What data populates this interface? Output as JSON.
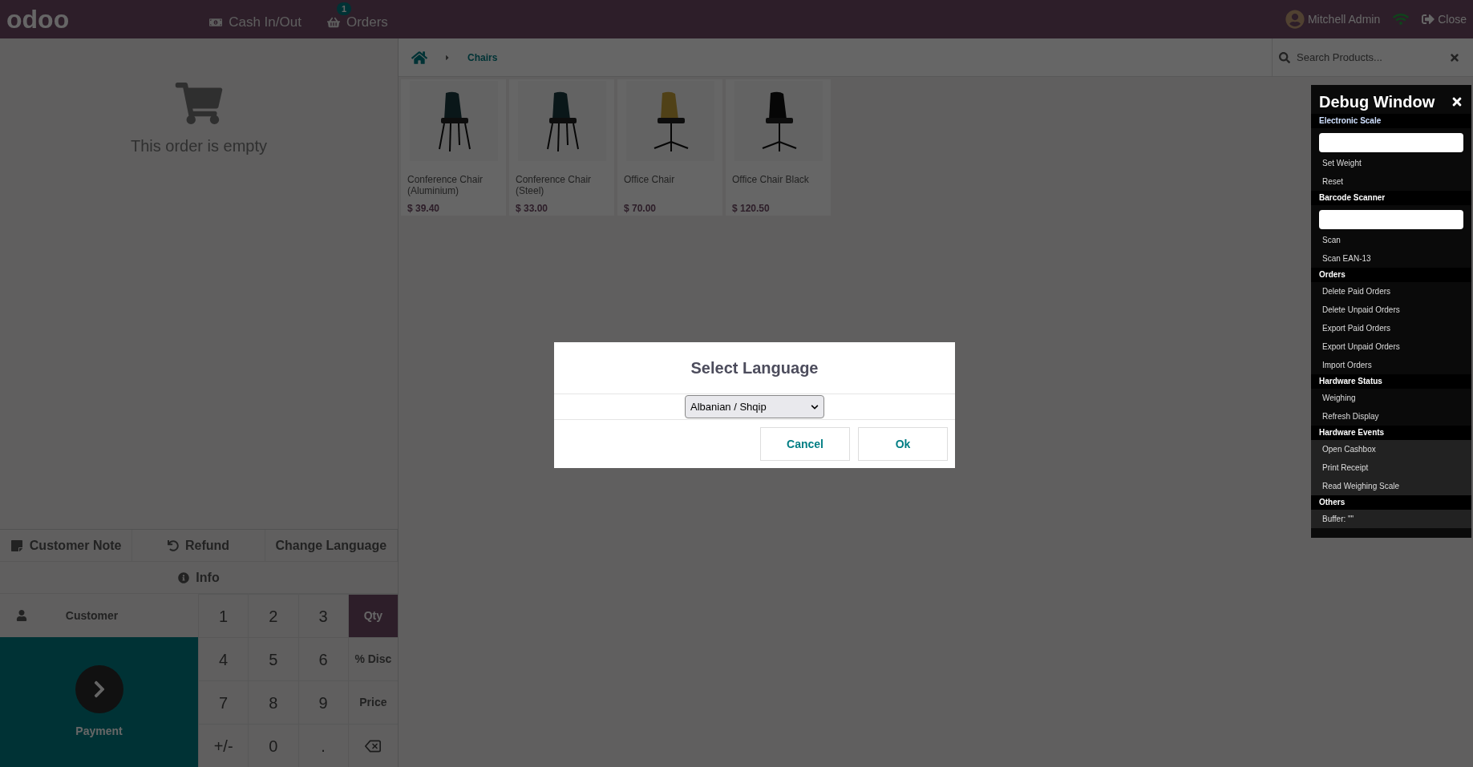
{
  "topbar": {
    "logo": "odoo",
    "buttons": [
      {
        "kind": "cash",
        "label": "Cash In/Out"
      },
      {
        "kind": "orders",
        "label": "Orders",
        "badge": "1"
      }
    ],
    "user": "Mitchell Admin",
    "close": "Close"
  },
  "breadcrumb": {
    "items": [
      "Chairs"
    ]
  },
  "search": {
    "placeholder": "Search Products..."
  },
  "products": [
    {
      "name": "Conference Chair (Aluminium)",
      "price": "$ 39.40"
    },
    {
      "name": "Conference Chair (Steel)",
      "price": "$ 33.00"
    },
    {
      "name": "Office Chair",
      "price": "$ 70.00"
    },
    {
      "name": "Office Chair Black",
      "price": "$ 120.50"
    }
  ],
  "order": {
    "empty_text": "This order is empty"
  },
  "control_buttons": [
    {
      "kind": "note",
      "label": "Customer Note"
    },
    {
      "kind": "refund",
      "label": "Refund"
    },
    {
      "kind": "plain",
      "label": "Change Language"
    }
  ],
  "info": "Info",
  "customer": "Customer",
  "payment": "Payment",
  "numpad": [
    {
      "kind": "digit",
      "label": "1"
    },
    {
      "kind": "digit",
      "label": "2"
    },
    {
      "kind": "digit",
      "label": "3"
    },
    {
      "kind": "mode",
      "label": "Qty",
      "selected": true
    },
    {
      "kind": "digit",
      "label": "4"
    },
    {
      "kind": "digit",
      "label": "5"
    },
    {
      "kind": "digit",
      "label": "6"
    },
    {
      "kind": "mode",
      "label": "% Disc",
      "selected": false
    },
    {
      "kind": "digit",
      "label": "7"
    },
    {
      "kind": "digit",
      "label": "8"
    },
    {
      "kind": "digit",
      "label": "9"
    },
    {
      "kind": "mode",
      "label": "Price",
      "selected": false
    },
    {
      "kind": "digit",
      "label": "+/-"
    },
    {
      "kind": "digit",
      "label": "0"
    },
    {
      "kind": "digit",
      "label": "."
    },
    {
      "kind": "backspace"
    }
  ],
  "debug": {
    "title": "Debug Window",
    "sections": [
      {
        "title": "Electronic Scale",
        "kind": "input",
        "items": [
          "Set Weight",
          "Reset"
        ]
      },
      {
        "title": "Barcode Scanner",
        "kind": "input",
        "items": [
          "Scan",
          "Scan EAN-13"
        ]
      },
      {
        "title": "Orders",
        "kind": "plain",
        "items": [
          "Delete Paid Orders",
          "Delete Unpaid Orders",
          "Export Paid Orders",
          "Export Unpaid Orders",
          "Import Orders"
        ]
      },
      {
        "title": "Hardware Status",
        "kind": "plain",
        "items": [
          "Weighing",
          "Refresh Display"
        ]
      },
      {
        "title": "Hardware Events",
        "kind": "plain",
        "items": [
          "Open Cashbox",
          "Print Receipt",
          "Read Weighing Scale"
        ]
      },
      {
        "title": "Others",
        "kind": "plain",
        "items": [
          "Buffer: \"\""
        ]
      }
    ]
  },
  "dialog": {
    "title": "Select Language",
    "select": "Albanian / Shqip",
    "buttons": [
      "Cancel",
      "Ok"
    ]
  }
}
